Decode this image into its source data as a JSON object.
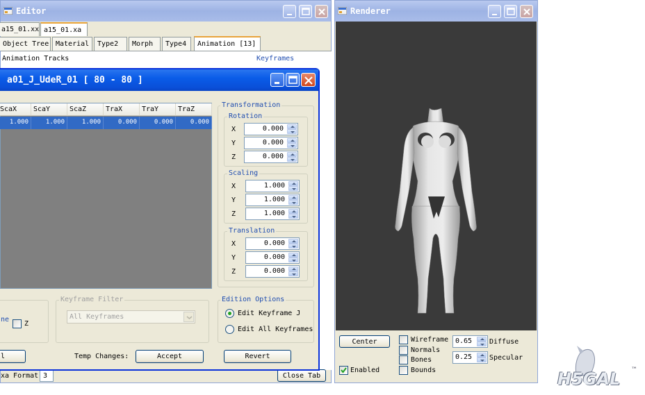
{
  "editor": {
    "title": "Editor",
    "file_tabs": [
      "a15_01.xx",
      "a15_01.xa"
    ],
    "section_tabs": [
      "Object Tree",
      "Material",
      "Type2",
      "Morph",
      "Type4",
      "Animation [13]"
    ],
    "animation_tracks_label": "Animation Tracks",
    "keyframes_label": "Keyframes",
    "status_label": "xa Format",
    "status_value": "3",
    "close_tab_label": "Close Tab"
  },
  "keyframe_dialog": {
    "title": "a01_J_UdeR_01 [ 80 - 80 ]",
    "columns": [
      "ScaX",
      "ScaY",
      "ScaZ",
      "TraX",
      "TraY",
      "TraZ"
    ],
    "row": [
      "1.000",
      "1.000",
      "1.000",
      "0.000",
      "0.000",
      "0.000"
    ],
    "transformation_label": "Transformation",
    "rotation": {
      "label": "Rotation",
      "x": "0.000",
      "y": "0.000",
      "z": "0.000"
    },
    "scaling": {
      "label": "Scaling",
      "x": "1.000",
      "y": "1.000",
      "z": "1.000"
    },
    "translation": {
      "label": "Translation",
      "x": "0.000",
      "y": "0.000",
      "z": "0.000"
    },
    "axis_labels": {
      "x": "X",
      "y": "Y",
      "z": "Z"
    },
    "interpolation_partial": "ne",
    "z_check_label": "Z",
    "keyframe_filter_label": "Keyframe Filter",
    "keyframe_filter_value": "All Keyframes",
    "edition_options_label": "Edition Options",
    "edit_keyframe_label": "Edit Keyframe J",
    "edit_all_label": "Edit All Keyframes",
    "left_button_partial": "l",
    "temp_changes_label": "Temp Changes:",
    "accept_label": "Accept",
    "revert_label": "Revert"
  },
  "renderer": {
    "title": "Renderer",
    "center_label": "Center",
    "enabled_label": "Enabled",
    "wireframe_label": "Wireframe",
    "normals_label": "Normals",
    "bones_label": "Bones",
    "bounds_label": "Bounds",
    "diffuse_value": "0.65",
    "diffuse_label": "Diffuse",
    "specular_value": "0.25",
    "specular_label": "Specular"
  },
  "watermark": "H5GAL",
  "colors": {
    "active_title": "#0a5ce8",
    "viewport_bg": "#3a3a3a",
    "selection": "#316ac5",
    "group_title": "#1f4db0"
  }
}
